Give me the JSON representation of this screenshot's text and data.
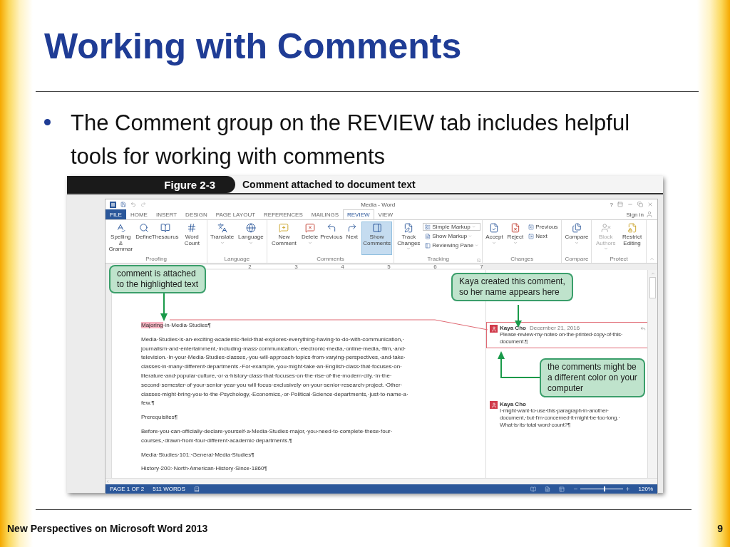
{
  "slide": {
    "title": "Working with Comments",
    "bullets": [
      {
        "text": "The Comment group on the REVIEW tab includes helpful tools for working with comments"
      }
    ],
    "footer": "New Perspectives on Microsoft Word 2013",
    "page_number": "9"
  },
  "figure": {
    "number": "Figure 2-3",
    "caption": "Comment attached to document text"
  },
  "word": {
    "title": "Media - Word",
    "help": "?",
    "sign_in": "Sign in",
    "tabs": [
      {
        "label": "FILE",
        "kind": "file",
        "selected": false
      },
      {
        "label": "HOME",
        "kind": "tab",
        "selected": false
      },
      {
        "label": "INSERT",
        "kind": "tab",
        "selected": false
      },
      {
        "label": "DESIGN",
        "kind": "tab",
        "selected": false
      },
      {
        "label": "PAGE LAYOUT",
        "kind": "tab",
        "selected": false
      },
      {
        "label": "REFERENCES",
        "kind": "tab",
        "selected": false
      },
      {
        "label": "MAILINGS",
        "kind": "tab",
        "selected": false
      },
      {
        "label": "REVIEW",
        "kind": "tab",
        "selected": true
      },
      {
        "label": "VIEW",
        "kind": "tab",
        "selected": false
      }
    ],
    "ribbon": [
      {
        "label": "Proofing",
        "items": [
          {
            "kind": "large",
            "label": "Spelling & Grammar"
          },
          {
            "kind": "large",
            "label": "Define"
          },
          {
            "kind": "large",
            "label": "Thesaurus"
          },
          {
            "kind": "large",
            "label": "Word Count"
          }
        ]
      },
      {
        "label": "Language",
        "items": [
          {
            "kind": "large",
            "label": "Translate",
            "dropdown": true
          },
          {
            "kind": "large",
            "label": "Language",
            "dropdown": true
          }
        ]
      },
      {
        "label": "Comments",
        "items": [
          {
            "kind": "large",
            "label": "New Comment"
          },
          {
            "kind": "large",
            "label": "Delete",
            "dropdown": true
          },
          {
            "kind": "large",
            "label": "Previous"
          },
          {
            "kind": "large",
            "label": "Next"
          },
          {
            "kind": "large",
            "label": "Show Comments",
            "selected": true
          }
        ]
      },
      {
        "label": "Tracking",
        "launcher": true,
        "items": [
          {
            "kind": "large",
            "label": "Track Changes",
            "dropdown": true
          },
          {
            "kind": "stack",
            "items": [
              {
                "kind": "select",
                "label": "Simple Markup"
              },
              {
                "kind": "small",
                "label": "Show Markup",
                "dropdown": true
              },
              {
                "kind": "small",
                "label": "Reviewing Pane",
                "dropdown": true
              }
            ]
          }
        ]
      },
      {
        "label": "Changes",
        "items": [
          {
            "kind": "large",
            "label": "Accept",
            "dropdown": true
          },
          {
            "kind": "large",
            "label": "Reject",
            "dropdown": true
          },
          {
            "kind": "stack",
            "items": [
              {
                "kind": "small",
                "label": "Previous"
              },
              {
                "kind": "small",
                "label": "Next"
              }
            ]
          }
        ]
      },
      {
        "label": "Compare",
        "items": [
          {
            "kind": "large",
            "label": "Compare",
            "dropdown": true
          }
        ]
      },
      {
        "label": "Protect",
        "items": [
          {
            "kind": "large",
            "label": "Block Authors",
            "dropdown": true,
            "disabled": true
          },
          {
            "kind": "large",
            "label": "Restrict Editing"
          }
        ]
      }
    ],
    "ruler": [
      "2",
      "3",
      "4",
      "5",
      "6",
      "7"
    ],
    "document": {
      "heading": {
        "highlighted": "Majoring",
        "rest": "·in·Media·Studies¶"
      },
      "paragraphs": [
        {
          "lines": [
            "Media·Studies·is·an·exciting·academic·field·that·explores·everything·having·to·do·with·communication,·",
            "journalism·and·entertainment,·including·mass·communication,·electronic·media,·online·media,·film,·and·",
            "television.·In·your·Media·Studies·classes,·you·will·approach·topics·from·varying·perspectives,·and·take·",
            "classes·in·many·different·departments.·For·example,·you·might·take·an·English·class·that·focuses·on·",
            "literature·and·popular·culture,·or·a·history·class·that·focuses·on·the·rise·of·the·modern·city.·In·the·",
            "second·semester·of·your·senior·year·you·will·focus·exclusively·on·your·senior·research·project.·Other·",
            "classes·might·bring·you·to·the·Psychology,·Economics,·or·Political·Science·departments,·just·to·name·a·",
            "few.¶"
          ]
        },
        {
          "lines": [
            "Prerequisites¶"
          ]
        },
        {
          "lines": [
            "Before·you·can·officially·declare·yourself·a·Media·Studies·major,·you·need·to·complete·these·four·",
            "courses,·drawn·from·four·different·academic·departments.¶"
          ]
        },
        {
          "lines": [
            "Media·Studies·101:·General·Media·Studies¶"
          ]
        },
        {
          "lines": [
            "History·200:·North·American·History·Since·1860¶"
          ]
        }
      ]
    },
    "comments": [
      {
        "author": "Kaya Cho",
        "date": "December 21, 2016",
        "lines": [
          "Please·review·my·notes·on·the·printed·copy·of·this·",
          "document.¶"
        ],
        "selected": true
      },
      {
        "author": "Kaya Cho",
        "lines": [
          "I·might·want·to·use·this·paragraph·in·another·",
          "document,·but·I'm·concerned·it·might·be·too·long.·",
          "What·is·its·total·word·count?¶"
        ],
        "selected": false
      }
    ],
    "status": {
      "page": "PAGE 1 OF 2",
      "words": "511 WORDS",
      "zoom": {
        "level": 0.55,
        "reading": "120%"
      }
    }
  },
  "callouts": [
    {
      "lines": [
        "comment is attached",
        "to the highlighted text"
      ]
    },
    {
      "lines": [
        "Kaya created this comment,",
        "so her name appears here"
      ]
    },
    {
      "lines": [
        "the comments might be",
        "a different color on your",
        "computer"
      ]
    }
  ]
}
